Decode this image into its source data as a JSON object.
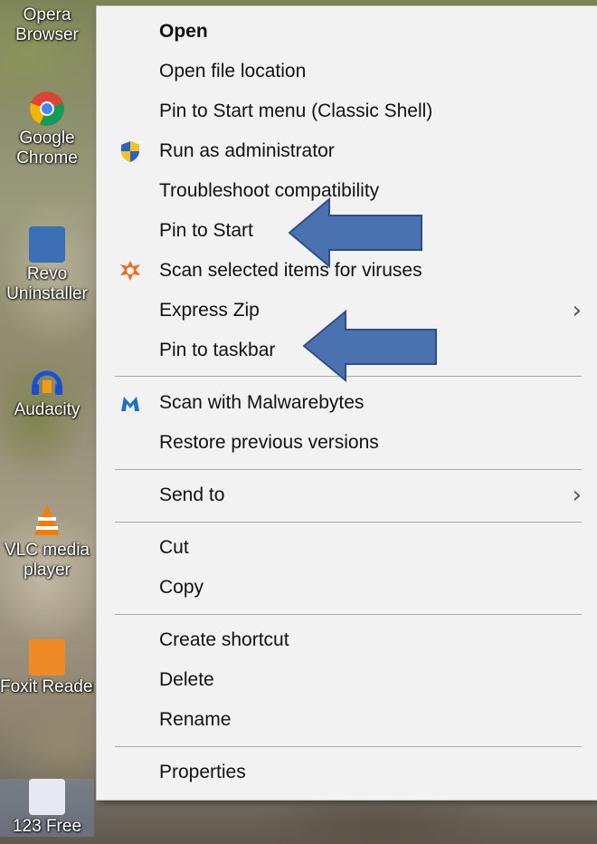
{
  "desktop": {
    "icons": [
      {
        "label_line1": "Opera",
        "label_line2": "Browser"
      },
      {
        "label_line1": "Google",
        "label_line2": "Chrome"
      },
      {
        "label_line1": "Revo",
        "label_line2": "Uninstaller"
      },
      {
        "label_line1": "Audacity",
        "label_line2": ""
      },
      {
        "label_line1": "VLC media",
        "label_line2": "player"
      },
      {
        "label_line1": "Foxit Reader",
        "label_line2": ""
      },
      {
        "label_line1": "123 Free",
        "label_line2": ""
      }
    ]
  },
  "context_menu": {
    "items": [
      {
        "label": "Open",
        "bold": true
      },
      {
        "label": "Open file location"
      },
      {
        "label": "Pin to Start menu (Classic Shell)"
      },
      {
        "label": "Run as administrator",
        "icon": "uac-shield-icon"
      },
      {
        "label": "Troubleshoot compatibility"
      },
      {
        "label": "Pin to Start"
      },
      {
        "label": "Scan selected items for viruses",
        "icon": "avast-icon"
      },
      {
        "label": "Express Zip",
        "submenu": true
      },
      {
        "label": "Pin to taskbar"
      },
      {
        "label": "Scan with Malwarebytes",
        "icon": "malwarebytes-icon"
      },
      {
        "label": "Restore previous versions"
      },
      {
        "label": "Send to",
        "submenu": true
      },
      {
        "label": "Cut"
      },
      {
        "label": "Copy"
      },
      {
        "label": "Create shortcut"
      },
      {
        "label": "Delete"
      },
      {
        "label": "Rename"
      },
      {
        "label": "Properties"
      }
    ],
    "submenu_glyph": "›"
  },
  "colors": {
    "menu_bg": "#f2f2f2",
    "separator": "#a8a8a8",
    "arrow_fill": "#4a72b0",
    "arrow_stroke": "#2e4f86"
  }
}
